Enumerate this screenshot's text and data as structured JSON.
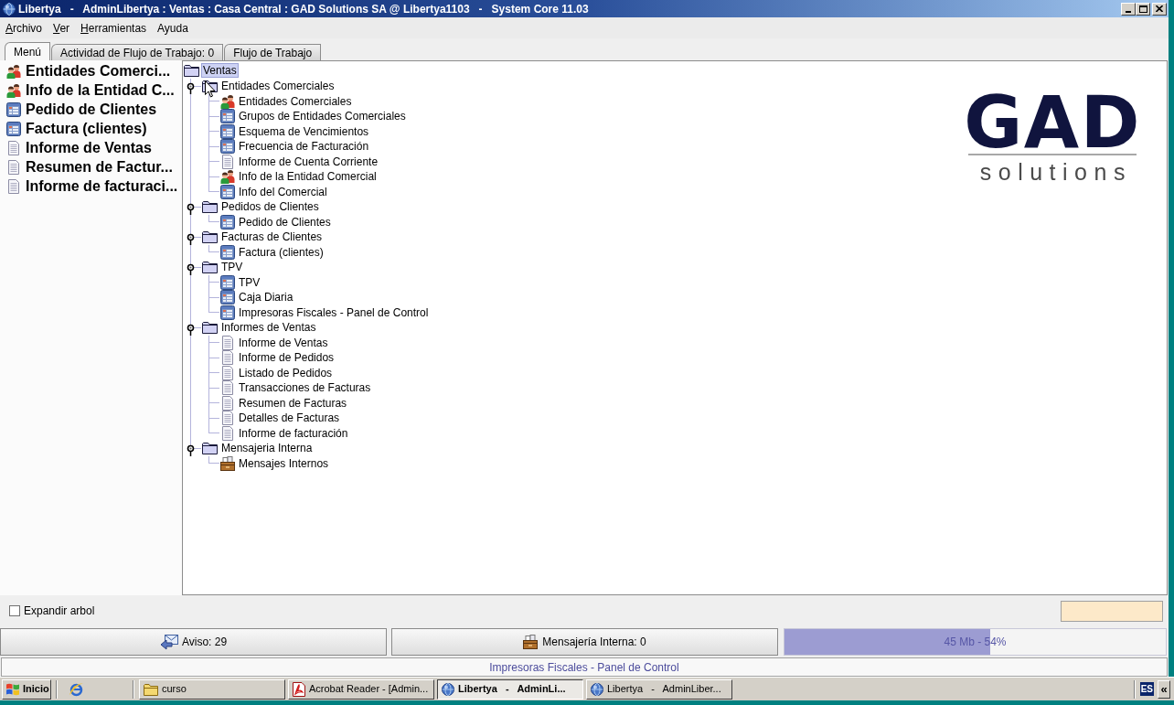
{
  "window": {
    "title": "Libertya   -   AdminLibertya : Ventas : Casa Central : GAD Solutions SA @ Libertya1103   -   System Core 11.03"
  },
  "menu_bar": [
    {
      "label": "Archivo",
      "mnemonic": true
    },
    {
      "label": "Ver",
      "mnemonic": true
    },
    {
      "label": "Herramientas",
      "mnemonic": true
    },
    {
      "label": "Ayuda",
      "mnemonic": false
    }
  ],
  "tabs": [
    {
      "label": "Menú",
      "selected": true
    },
    {
      "label": "Actividad de Flujo de Trabajo: 0",
      "selected": false
    },
    {
      "label": "Flujo de Trabajo",
      "selected": false
    }
  ],
  "favorites": [
    {
      "label": "Entidades Comerci...",
      "kind": "people"
    },
    {
      "label": "Info de la Entidad C...",
      "kind": "people"
    },
    {
      "label": "Pedido de Clientes",
      "kind": "window"
    },
    {
      "label": "Factura (clientes)",
      "kind": "window"
    },
    {
      "label": "Informe de Ventas",
      "kind": "report"
    },
    {
      "label": "Resumen de Factur...",
      "kind": "report"
    },
    {
      "label": "Informe de facturaci...",
      "kind": "report"
    }
  ],
  "tree": {
    "root": {
      "label": "Ventas",
      "selected": true
    },
    "nodes": [
      {
        "label": "Entidades Comerciales",
        "kind": "folder",
        "selected": false,
        "expanded": true,
        "children": [
          {
            "label": "Entidades Comerciales",
            "kind": "people",
            "selected": false
          },
          {
            "label": "Grupos de Entidades Comerciales",
            "kind": "window",
            "selected": false
          },
          {
            "label": "Esquema de Vencimientos",
            "kind": "window",
            "selected": false
          },
          {
            "label": "Frecuencia de Facturación",
            "kind": "window",
            "selected": false
          },
          {
            "label": "Informe de Cuenta Corriente",
            "kind": "report",
            "selected": false
          },
          {
            "label": "Info de la Entidad Comercial",
            "kind": "people",
            "selected": false
          },
          {
            "label": "Info del Comercial",
            "kind": "window",
            "selected": false
          }
        ]
      },
      {
        "label": "Pedidos de Clientes",
        "kind": "folder",
        "selected": false,
        "expanded": true,
        "children": [
          {
            "label": "Pedido de Clientes",
            "kind": "window",
            "selected": false
          }
        ]
      },
      {
        "label": "Facturas de Clientes",
        "kind": "folder",
        "selected": false,
        "expanded": true,
        "children": [
          {
            "label": "Factura (clientes)",
            "kind": "window",
            "selected": false
          }
        ]
      },
      {
        "label": "TPV",
        "kind": "folder",
        "selected": false,
        "expanded": true,
        "children": [
          {
            "label": "TPV",
            "kind": "window",
            "selected": false
          },
          {
            "label": "Caja Diaria",
            "kind": "window",
            "selected": false
          },
          {
            "label": "Impresoras Fiscales - Panel de Control",
            "kind": "window",
            "selected": false
          }
        ]
      },
      {
        "label": "Informes de Ventas",
        "kind": "folder",
        "selected": false,
        "expanded": true,
        "children": [
          {
            "label": "Informe de Ventas",
            "kind": "report",
            "selected": false
          },
          {
            "label": "Informe de Pedidos",
            "kind": "report",
            "selected": false
          },
          {
            "label": "Listado de Pedidos",
            "kind": "report",
            "selected": false
          },
          {
            "label": "Transacciones de Facturas",
            "kind": "report",
            "selected": false
          },
          {
            "label": "Resumen de Facturas",
            "kind": "report",
            "selected": false
          },
          {
            "label": "Detalles de Facturas",
            "kind": "report",
            "selected": false
          },
          {
            "label": "Informe de facturación",
            "kind": "report",
            "selected": false
          }
        ]
      },
      {
        "label": "Mensajeria Interna",
        "kind": "folder",
        "selected": false,
        "expanded": true,
        "children": [
          {
            "label": "Mensajes Internos",
            "kind": "messages",
            "selected": false
          }
        ]
      }
    ]
  },
  "logo": {
    "mark": "GAD",
    "tagline": "solutions"
  },
  "expand_tree": {
    "label": "Expandir arbol",
    "checked": false
  },
  "status_bar": {
    "alerts": "Aviso: 29",
    "messages": "Mensajería Interna: 0",
    "memory": {
      "level": 0.54,
      "reading": "45 Mb - 54%"
    },
    "message": "Impresoras Fiscales - Panel de Control"
  },
  "taskbar": {
    "start": "Inicio",
    "items": [
      {
        "label": "curso",
        "kind": "folder",
        "selected": false
      },
      {
        "label": "Acrobat Reader - [Admin...",
        "kind": "pdf",
        "selected": false
      },
      {
        "label": "Libertya   -   AdminLi...",
        "kind": "app",
        "selected": true
      },
      {
        "label": "Libertya   -   AdminLiber...",
        "kind": "app",
        "selected": false
      }
    ],
    "language": "ES",
    "tray_toggle": "«"
  }
}
